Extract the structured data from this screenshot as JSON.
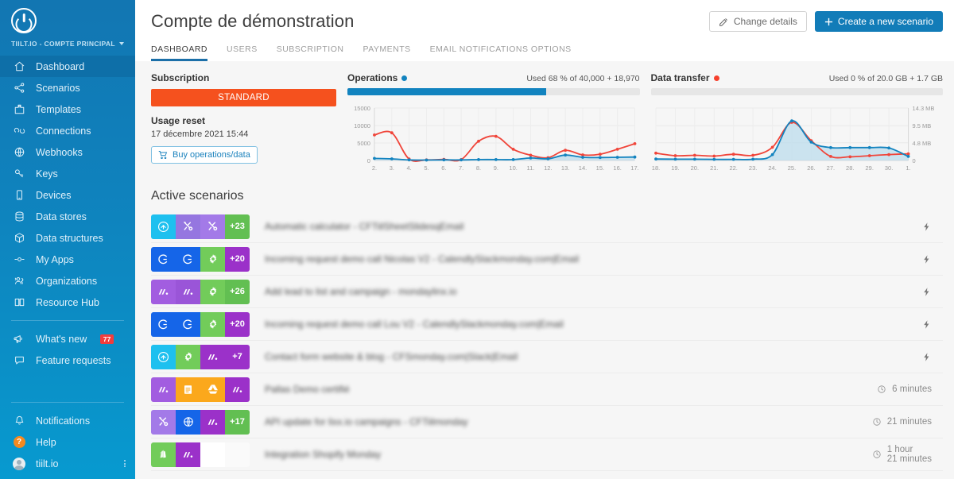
{
  "sidebar": {
    "logo_icon": "power-circle-logo",
    "account_label": "TIILT.IO - COMPTE PRINCIPAL",
    "items": [
      {
        "label": "Dashboard",
        "icon": "home-icon",
        "active": true
      },
      {
        "label": "Scenarios",
        "icon": "share-nodes-icon",
        "active": false
      },
      {
        "label": "Templates",
        "icon": "templates-icon",
        "active": false
      },
      {
        "label": "Connections",
        "icon": "link-icon",
        "active": false
      },
      {
        "label": "Webhooks",
        "icon": "globe-icon",
        "active": false
      },
      {
        "label": "Keys",
        "icon": "key-icon",
        "active": false
      },
      {
        "label": "Devices",
        "icon": "device-icon",
        "active": false
      },
      {
        "label": "Data stores",
        "icon": "database-icon",
        "active": false
      },
      {
        "label": "Data structures",
        "icon": "cube-icon",
        "active": false
      },
      {
        "label": "My Apps",
        "icon": "my-apps-icon",
        "active": false
      },
      {
        "label": "Organizations",
        "icon": "organizations-icon",
        "active": false
      },
      {
        "label": "Resource Hub",
        "icon": "book-icon",
        "active": false
      }
    ],
    "secondary_items": [
      {
        "label": "What's new",
        "icon": "megaphone-icon",
        "badge": "77"
      },
      {
        "label": "Feature requests",
        "icon": "comment-icon",
        "badge": ""
      }
    ],
    "bottom_items": [
      {
        "label": "Notifications",
        "icon": "bell-icon"
      },
      {
        "label": "Help",
        "icon": "help-icon"
      },
      {
        "label": "tiilt.io",
        "icon": "avatar"
      }
    ]
  },
  "header": {
    "title": "Compte de démonstration",
    "change_details_label": "Change details",
    "change_details_icon": "edit-pencil-icon",
    "create_scenario_label": "Create a new scenario",
    "create_scenario_icon": "plus-icon",
    "tabs": [
      {
        "label": "DASHBOARD",
        "active": true
      },
      {
        "label": "USERS",
        "active": false
      },
      {
        "label": "SUBSCRIPTION",
        "active": false
      },
      {
        "label": "PAYMENTS",
        "active": false
      },
      {
        "label": "EMAIL NOTIFICATIONS OPTIONS",
        "active": false
      }
    ]
  },
  "subscription": {
    "title": "Subscription",
    "plan": "STANDARD",
    "plan_color": "#f5511e",
    "usage_reset_label": "Usage reset",
    "usage_reset_value": "17 décembre 2021 15:44",
    "buy_label": "Buy operations/data",
    "buy_icon": "cart-icon"
  },
  "operations": {
    "label": "Operations",
    "dot_color": "#1283bf",
    "used_text": "Used 68 % of 40,000 + 18,970",
    "progress_percent": 68
  },
  "data_transfer": {
    "label": "Data transfer",
    "dot_color": "#f6402c",
    "used_text": "Used 0 % of 20.0 GB + 1.7 GB",
    "progress_percent": 0
  },
  "chart_data": [
    {
      "type": "line",
      "title": "Operations",
      "xlabel": "",
      "ylabel": "",
      "ylim": [
        0,
        15000
      ],
      "yticks": [
        0,
        5000,
        10000,
        15000
      ],
      "ytick_labels": [
        "0",
        "5000",
        "10000",
        "15000"
      ],
      "grid": true,
      "legend_position": "none",
      "x": [
        "2.",
        "3.",
        "4.",
        "5.",
        "6.",
        "7.",
        "8.",
        "9.",
        "10.",
        "11.",
        "12.",
        "13.",
        "14.",
        "15.",
        "16.",
        "17."
      ],
      "series": [
        {
          "name": "operations-red",
          "color": "#f0453a",
          "values": [
            7300,
            7900,
            400,
            150,
            300,
            250,
            5500,
            6900,
            3200,
            1500,
            800,
            2900,
            1600,
            1800,
            3200,
            4800
          ]
        },
        {
          "name": "operations-blue",
          "color": "#1283bf",
          "values": [
            600,
            450,
            150,
            120,
            150,
            150,
            250,
            260,
            240,
            700,
            480,
            1550,
            900,
            850,
            900,
            980
          ]
        }
      ]
    },
    {
      "type": "line",
      "title": "Data transfer",
      "xlabel": "",
      "ylabel": "",
      "ylim": [
        0,
        14.3
      ],
      "yticks": [
        0,
        4.8,
        9.5,
        14.3
      ],
      "ytick_labels": [
        "0",
        "4.8 MB",
        "9.5 MB",
        "14.3 MB"
      ],
      "grid": true,
      "legend_position": "none",
      "x": [
        "18.",
        "19.",
        "20.",
        "21.",
        "22.",
        "23.",
        "24.",
        "25.",
        "26.",
        "27.",
        "28.",
        "29.",
        "30.",
        "1."
      ],
      "series": [
        {
          "name": "data-red",
          "color": "#f0453a",
          "values": [
            2.0,
            1.3,
            1.4,
            1.2,
            1.7,
            1.4,
            3.6,
            10.4,
            5.4,
            1.1,
            1.0,
            1.3,
            1.6,
            1.8
          ]
        },
        {
          "name": "data-blue",
          "color": "#1283bf",
          "values": [
            0.4,
            0.35,
            0.35,
            0.3,
            0.3,
            0.35,
            1.6,
            10.8,
            5.0,
            3.5,
            3.5,
            3.5,
            3.4,
            1.1
          ]
        }
      ]
    }
  ],
  "active_scenarios": {
    "title": "Active scenarios",
    "rows": [
      {
        "name": "Automatic calculator - CFTiilSheetSlidesqEmail",
        "badges": [
          {
            "icon": "cloud-arrow-up-icon",
            "color": "#1ec0ef",
            "text": ""
          },
          {
            "icon": "tools-icon",
            "color": "#9576e0",
            "text": ""
          },
          {
            "icon": "tools-icon",
            "color": "#a37ae8",
            "text": ""
          },
          {
            "icon": "count",
            "color": "#62bf52",
            "text": "+23"
          }
        ],
        "status_icon": "bolt-icon",
        "status_text": ""
      },
      {
        "name": "Incoming request demo call Nicolas V2 - CalendlySlackmonday.com|Email",
        "badges": [
          {
            "icon": "circle-c-icon",
            "color": "#1565e8",
            "text": ""
          },
          {
            "icon": "circle-c-icon",
            "color": "#1565e8",
            "text": ""
          },
          {
            "icon": "gear-icon",
            "color": "#72cc5a",
            "text": ""
          },
          {
            "icon": "count",
            "color": "#9b31c9",
            "text": "+20"
          }
        ],
        "status_icon": "bolt-icon",
        "status_text": ""
      },
      {
        "name": "Add lead to list and campaign - mondaylinx.io",
        "badges": [
          {
            "icon": "monday-icon",
            "color": "#a25de0",
            "text": ""
          },
          {
            "icon": "monday-icon",
            "color": "#9a55d8",
            "text": ""
          },
          {
            "icon": "gear-icon",
            "color": "#72cc5a",
            "text": ""
          },
          {
            "icon": "count",
            "color": "#62bf52",
            "text": "+26"
          }
        ],
        "status_icon": "bolt-icon",
        "status_text": ""
      },
      {
        "name": "Incoming request demo call Lou V2 - CalendlySlackmonday.com|Email",
        "badges": [
          {
            "icon": "circle-c-icon",
            "color": "#1565e8",
            "text": ""
          },
          {
            "icon": "circle-c-icon",
            "color": "#1565e8",
            "text": ""
          },
          {
            "icon": "gear-icon",
            "color": "#72cc5a",
            "text": ""
          },
          {
            "icon": "count",
            "color": "#9b31c9",
            "text": "+20"
          }
        ],
        "status_icon": "bolt-icon",
        "status_text": ""
      },
      {
        "name": "Contact form website & blog - CFSmonday.com|Slack|Email",
        "badges": [
          {
            "icon": "cloud-arrow-up-icon",
            "color": "#1ec0ef",
            "text": ""
          },
          {
            "icon": "gear-icon",
            "color": "#72cc5a",
            "text": ""
          },
          {
            "icon": "monday-icon",
            "color": "#9b31c9",
            "text": ""
          },
          {
            "icon": "count",
            "color": "#9b31c9",
            "text": "+7"
          }
        ],
        "status_icon": "bolt-icon",
        "status_text": ""
      },
      {
        "name": "Pallas Demo certifié",
        "badges": [
          {
            "icon": "monday-icon",
            "color": "#a25de0",
            "text": ""
          },
          {
            "icon": "google-docs-icon",
            "color": "#fba81c",
            "text": ""
          },
          {
            "icon": "google-drive-icon",
            "color": "#fba81c",
            "text": ""
          },
          {
            "icon": "monday-icon",
            "color": "#9b31c9",
            "text": ""
          }
        ],
        "status_icon": "clock-icon",
        "status_text": "6 minutes"
      },
      {
        "name": "API update for lixx.io campaigns  - CFTiilmonday",
        "badges": [
          {
            "icon": "tools-icon",
            "color": "#a37ae8",
            "text": ""
          },
          {
            "icon": "globe-icon",
            "color": "#1565e8",
            "text": ""
          },
          {
            "icon": "monday-icon",
            "color": "#9b31c9",
            "text": ""
          },
          {
            "icon": "count",
            "color": "#62bf52",
            "text": "+17"
          }
        ],
        "status_icon": "clock-icon",
        "status_text": "21 minutes"
      },
      {
        "name": "Integration Shopify Monday",
        "badges": [
          {
            "icon": "shopify-icon",
            "color": "#72cc5a",
            "text": ""
          },
          {
            "icon": "monday-icon",
            "color": "#9b31c9",
            "text": ""
          },
          {
            "icon": "empty",
            "color": "#ffffff",
            "text": ""
          },
          {
            "icon": "empty",
            "color": "#fafafa",
            "text": ""
          }
        ],
        "status_icon": "clock-icon",
        "status_text": "1 hour\n21 minutes"
      }
    ]
  }
}
